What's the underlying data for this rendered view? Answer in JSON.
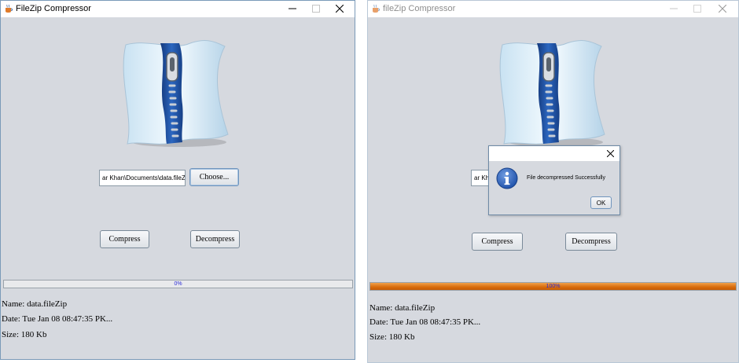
{
  "window_left": {
    "title": "FileZip Compressor",
    "path_value": "ar Khan\\Documents\\data.fileZip",
    "choose_label": "Choose...",
    "compress_label": "Compress",
    "decompress_label": "Decompress",
    "progress_fraction": 0.0,
    "progress_text": "0%",
    "info": {
      "name": "Name: data.fileZip",
      "date": "Date: Tue Jan 08 08:47:35 PK...",
      "size": "Size: 180 Kb"
    }
  },
  "window_right": {
    "title": "fileZip Compressor",
    "path_value": "ar Khan",
    "compress_label": "Compress",
    "decompress_label": "Decompress",
    "progress_fraction": 1.0,
    "progress_text": "100%",
    "info": {
      "name": "Name: data.fileZip",
      "date": "Date: Tue Jan 08 08:47:35 PK...",
      "size": "Size: 180 Kb"
    },
    "dialog": {
      "message": "File decompressed Successfully",
      "ok_label": "OK"
    }
  },
  "colors": {
    "window_bg": "#d6d9df",
    "progress_fill": "#d86b0c",
    "progress_text": "#2a2ad6",
    "zipper_blue": "#1f4fa0"
  },
  "icons": [
    "java-cup-icon",
    "minimize-icon",
    "maximize-icon",
    "close-icon",
    "zip-file-graphic",
    "info-icon"
  ]
}
